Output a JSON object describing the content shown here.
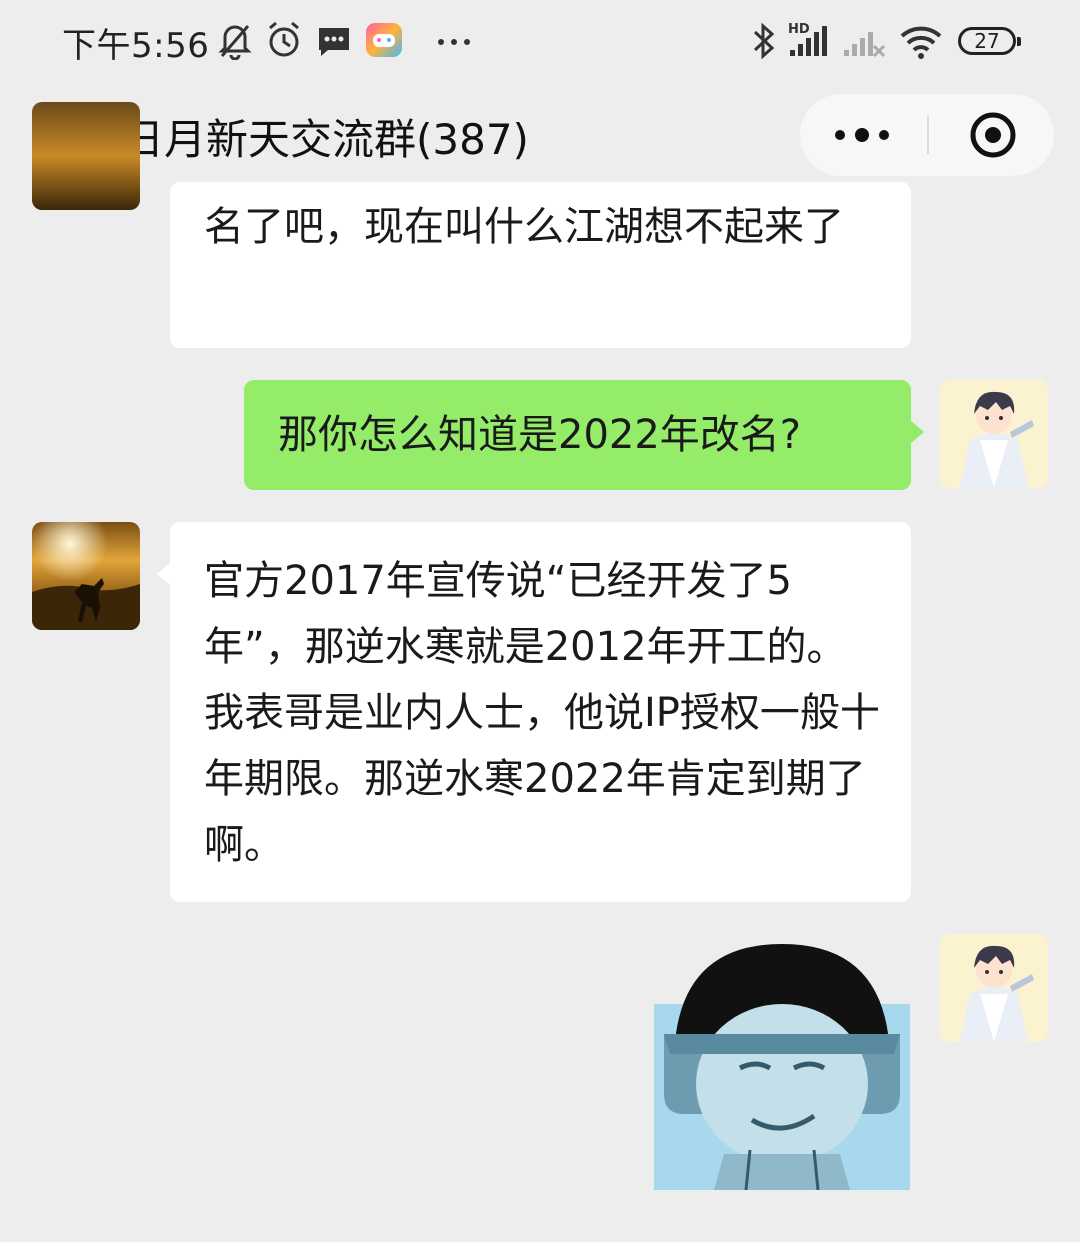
{
  "status_bar": {
    "time": "下午5:56",
    "icons": [
      "mute-bell-icon",
      "alarm-icon",
      "message-icon",
      "game-app-icon",
      "more-dots-icon",
      "bluetooth-icon",
      "signal-hd-icon",
      "signal-icon",
      "wifi-icon"
    ],
    "network_badge": "HD",
    "battery": "27"
  },
  "header": {
    "title": "日月新天交流群(387)",
    "back_icon": "chevron-left-icon",
    "menu_icon": "more-horizontal-icon",
    "close_icon": "target-circle-icon"
  },
  "messages": [
    {
      "side": "in",
      "sender_icon": "horse-rider-avatar",
      "text": "名了吧，现在叫什么江湖想不起来了"
    },
    {
      "side": "out",
      "sender_icon": "anime-character-avatar",
      "text": "那你怎么知道是2022年改名?"
    },
    {
      "side": "in",
      "sender_icon": "horse-rider-avatar",
      "text": "官方2017年宣传说“已经开发了5年”，那逆水寒就是2012年开工的。我表哥是业内人士，他说IP授权一般十年期限。那逆水寒2022年肯定到期了啊。"
    },
    {
      "side": "out",
      "sender_icon": "anime-character-avatar",
      "sticker": "smug-mushroom-head-meme"
    }
  ],
  "colors": {
    "background": "#ededed",
    "outgoing_bubble": "#95ec69",
    "incoming_bubble": "#ffffff",
    "sticker_tint": "#a8d8ee"
  }
}
